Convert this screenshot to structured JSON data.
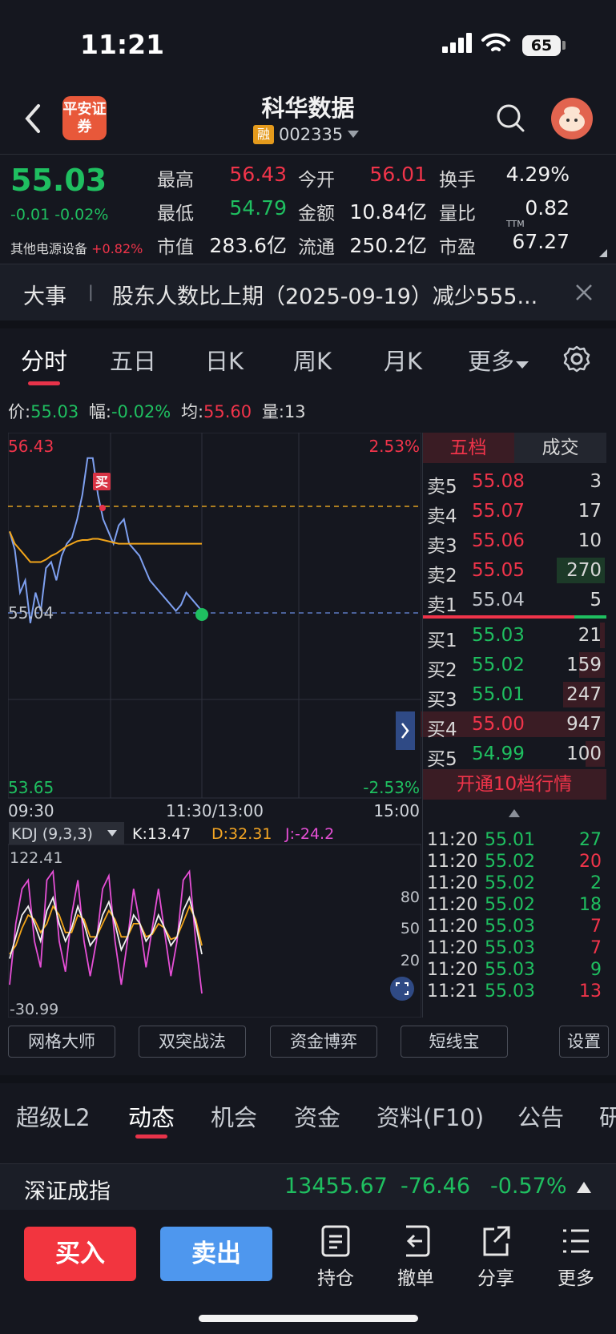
{
  "status": {
    "time": "11:21",
    "battery": "65"
  },
  "header": {
    "logo_text": "平安证券",
    "title": "科华数据",
    "margin_badge": "融",
    "code": "002335"
  },
  "quote": {
    "price": "55.03",
    "change": "-0.01 -0.02%",
    "sector": "其他电源设备",
    "sector_change": "+0.82%",
    "fields": [
      {
        "label": "最高",
        "value": "56.43",
        "color": "red"
      },
      {
        "label": "今开",
        "value": "56.01",
        "color": "red"
      },
      {
        "label": "换手",
        "value": "4.29%",
        "color": "white"
      },
      {
        "label": "最低",
        "value": "54.79",
        "color": "green"
      },
      {
        "label": "金额",
        "value": "10.84亿",
        "color": "white"
      },
      {
        "label": "量比",
        "value": "0.82",
        "color": "white"
      },
      {
        "label": "市值",
        "value": "283.6亿",
        "color": "white"
      },
      {
        "label": "流通",
        "value": "250.2亿",
        "color": "white"
      },
      {
        "label": "市盈",
        "value": "67.27",
        "color": "white"
      }
    ],
    "ttm": "TTM"
  },
  "news": {
    "label": "大事",
    "sep": "|",
    "text": "股东人数比上期（2025-09-19）减少555..."
  },
  "tabs": [
    "分时",
    "五日",
    "日K",
    "周K",
    "月K",
    "更多"
  ],
  "info": {
    "price_label": "价:",
    "price": "55.03",
    "amp_label": "幅:",
    "amp": "-0.02%",
    "avg_label": "均:",
    "avg": "55.60",
    "vol_label": "量:",
    "vol": "13"
  },
  "chart_data": {
    "type": "line",
    "title": "",
    "y_left": {
      "max": "56.43",
      "ref": "55.04",
      "min": "53.65"
    },
    "y_right": {
      "max": "2.53%",
      "min": "-2.53%"
    },
    "x_labels": [
      "09:30",
      "11:30/13:00",
      "15:00"
    ],
    "ylim": [
      53.65,
      56.43
    ],
    "prev_close": 55.04,
    "series": [
      {
        "values": [
          55.7,
          55.55,
          55.2,
          55.3,
          54.95,
          55.2,
          55.05,
          55.4,
          55.45,
          55.3,
          55.5,
          55.6,
          55.65,
          55.8,
          56.0,
          56.3,
          56.3,
          56.0,
          55.8,
          55.7,
          55.6,
          55.75,
          55.8,
          55.6,
          55.55,
          55.5,
          55.4,
          55.3,
          55.25,
          55.2,
          55.15,
          55.1,
          55.05,
          55.1,
          55.2,
          55.15,
          55.1,
          55.05
        ]
      },
      {
        "values": [
          55.7,
          55.6,
          55.55,
          55.5,
          55.45,
          55.45,
          55.45,
          55.47,
          55.5,
          55.52,
          55.55,
          55.58,
          55.6,
          55.62,
          55.63,
          55.63,
          55.64,
          55.64,
          55.63,
          55.62,
          55.61,
          55.6,
          55.6,
          55.6,
          55.6,
          55.6,
          55.6,
          55.6,
          55.6,
          55.6,
          55.6,
          55.6,
          55.6,
          55.6,
          55.6,
          55.6,
          55.6,
          55.6
        ]
      }
    ],
    "buy_marker": "买",
    "kdj": {
      "label": "KDJ (9,3,3)",
      "k_label": "K:13.47",
      "d_label": "D:32.31",
      "j_label": "J:-24.2",
      "max": "122.41",
      "min": "-30.99",
      "levels": [
        "80",
        "50",
        "20"
      ],
      "k": [
        20,
        45,
        70,
        80,
        60,
        40,
        75,
        90,
        60,
        40,
        55,
        80,
        60,
        35,
        45,
        70,
        85,
        60,
        30,
        45,
        70,
        60,
        40,
        50,
        70,
        55,
        35,
        45,
        75,
        90,
        60,
        25
      ],
      "d": [
        25,
        35,
        55,
        70,
        65,
        50,
        60,
        80,
        70,
        50,
        50,
        70,
        65,
        45,
        45,
        60,
        75,
        65,
        45,
        45,
        60,
        60,
        45,
        48,
        60,
        55,
        42,
        45,
        62,
        80,
        65,
        35
      ],
      "j": [
        -10,
        60,
        100,
        110,
        40,
        10,
        110,
        120,
        40,
        5,
        70,
        110,
        40,
        0,
        40,
        100,
        115,
        40,
        -10,
        40,
        100,
        60,
        10,
        55,
        100,
        50,
        0,
        40,
        110,
        120,
        40,
        -20
      ]
    },
    "gridlines": true
  },
  "book": {
    "tab_active": "五档",
    "tab_other": "成交",
    "asks": [
      {
        "label": "卖5",
        "price": "55.08",
        "vol": "3"
      },
      {
        "label": "卖4",
        "price": "55.07",
        "vol": "17"
      },
      {
        "label": "卖3",
        "price": "55.06",
        "vol": "10"
      },
      {
        "label": "卖2",
        "price": "55.05",
        "vol": "270"
      },
      {
        "label": "卖1",
        "price": "55.04",
        "vol": "5"
      }
    ],
    "bids": [
      {
        "label": "买1",
        "price": "55.03",
        "vol": "21"
      },
      {
        "label": "买2",
        "price": "55.02",
        "vol": "159"
      },
      {
        "label": "买3",
        "price": "55.01",
        "vol": "247"
      },
      {
        "label": "买4",
        "price": "55.00",
        "vol": "947"
      },
      {
        "label": "买5",
        "price": "54.99",
        "vol": "100"
      }
    ],
    "upgrade": "开通10档行情",
    "ticks": [
      {
        "t": "11:20",
        "p": "55.01",
        "v": "27",
        "vc": "green"
      },
      {
        "t": "11:20",
        "p": "55.02",
        "v": "20",
        "vc": "red"
      },
      {
        "t": "11:20",
        "p": "55.02",
        "v": "2",
        "vc": "green"
      },
      {
        "t": "11:20",
        "p": "55.02",
        "v": "18",
        "vc": "green"
      },
      {
        "t": "11:20",
        "p": "55.03",
        "v": "7",
        "vc": "red"
      },
      {
        "t": "11:20",
        "p": "55.03",
        "v": "7",
        "vc": "red"
      },
      {
        "t": "11:20",
        "p": "55.03",
        "v": "9",
        "vc": "green"
      },
      {
        "t": "11:21",
        "p": "55.03",
        "v": "13",
        "vc": "red"
      }
    ]
  },
  "tools": [
    "网格大师",
    "双突战法",
    "资金博弈",
    "短线宝",
    "设置"
  ],
  "bottom_tabs": [
    "超级L2",
    "动态",
    "机会",
    "资金",
    "资料(F10)",
    "公告",
    "研"
  ],
  "index": {
    "name": "深证成指",
    "value": "13455.67",
    "change": "-76.46",
    "pct": "-0.57%"
  },
  "actions": {
    "buy": "买入",
    "sell": "卖出",
    "hold": "持仓",
    "cancel": "撤单",
    "share": "分享",
    "more": "更多"
  }
}
